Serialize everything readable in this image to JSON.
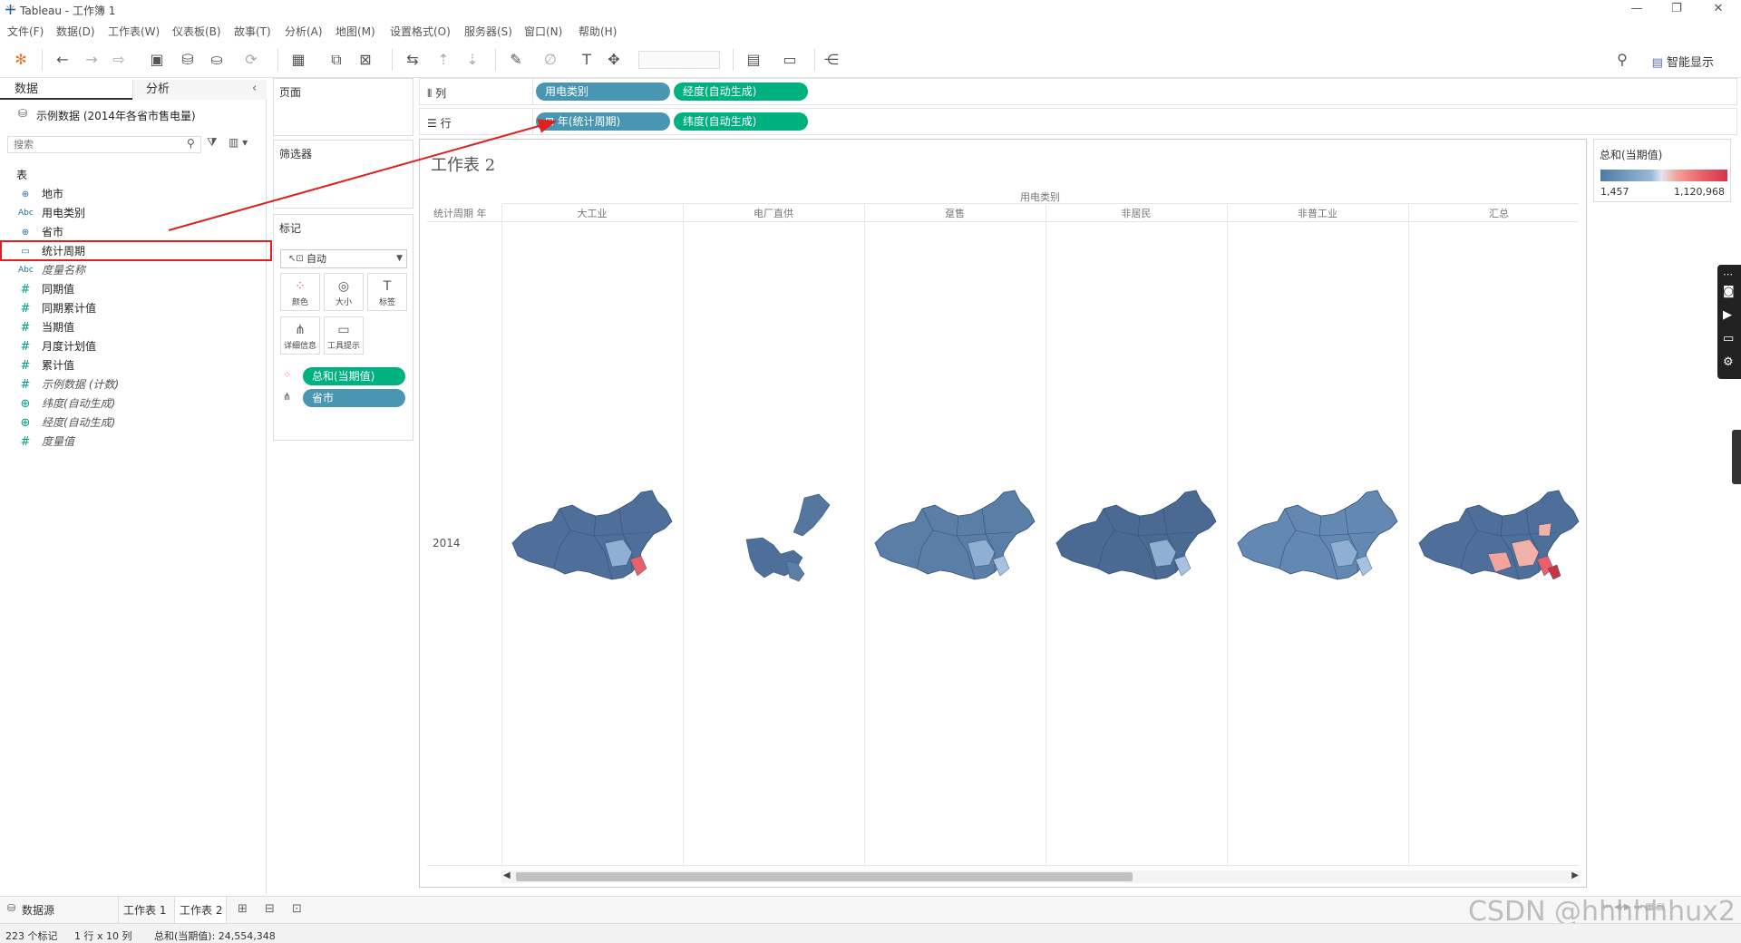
{
  "window": {
    "title": "Tableau - 工作簿 1"
  },
  "menu": [
    "文件(F)",
    "数据(D)",
    "工作表(W)",
    "仪表板(B)",
    "故事(T)",
    "分析(A)",
    "地图(M)",
    "设置格式(O)",
    "服务器(S)",
    "窗口(N)",
    "帮助(H)"
  ],
  "toolbar": {
    "smart_show": "智能显示"
  },
  "data_pane": {
    "tab_data": "数据",
    "tab_analysis": "分析",
    "datasource": "示例数据 (2014年各省市售电量)",
    "search_placeholder": "搜索",
    "section_label": "表",
    "fields": [
      {
        "icon": "globe-icon",
        "type": "geo",
        "name": "地市"
      },
      {
        "icon": "abc-icon",
        "type": "dim",
        "name": "用电类别"
      },
      {
        "icon": "globe-icon",
        "type": "geo",
        "name": "省市"
      },
      {
        "icon": "calendar-icon",
        "type": "date",
        "name": "统计周期",
        "selected": true
      },
      {
        "icon": "abc-icon",
        "type": "dim",
        "name": "度量名称",
        "italic": true
      },
      {
        "icon": "hash-icon",
        "type": "meas",
        "name": "同期值"
      },
      {
        "icon": "hash-icon",
        "type": "meas",
        "name": "同期累计值"
      },
      {
        "icon": "hash-icon",
        "type": "meas",
        "name": "当期值"
      },
      {
        "icon": "hash-icon",
        "type": "meas",
        "name": "月度计划值"
      },
      {
        "icon": "hash-icon",
        "type": "meas",
        "name": "累计值"
      },
      {
        "icon": "hash-icon",
        "type": "meas",
        "name": "示例数据 (计数)",
        "italic": true
      },
      {
        "icon": "globe-icon",
        "type": "geomeas",
        "name": "纬度(自动生成)",
        "italic": true
      },
      {
        "icon": "globe-icon",
        "type": "geomeas",
        "name": "经度(自动生成)",
        "italic": true
      },
      {
        "icon": "hash-icon",
        "type": "meas",
        "name": "度量值",
        "italic": true
      }
    ]
  },
  "cards": {
    "pages": "页面",
    "filters": "筛选器",
    "marks": "标记",
    "mark_type": "自动",
    "mark_buttons": [
      "颜色",
      "大小",
      "标签",
      "详细信息",
      "工具提示"
    ],
    "mark_pills": [
      {
        "label": "总和(当期值)",
        "kind": "measure",
        "icon": "color-icon"
      },
      {
        "label": "省市",
        "kind": "dimension",
        "icon": "detail-icon"
      }
    ]
  },
  "shelves": {
    "columns_label": "列",
    "rows_label": "行",
    "columns": [
      {
        "label": "用电类别",
        "kind": "dimension"
      },
      {
        "label": "经度(自动生成)",
        "kind": "measure"
      }
    ],
    "rows": [
      {
        "label": "⊞ 年(统计周期)",
        "kind": "dimension"
      },
      {
        "label": "纬度(自动生成)",
        "kind": "measure"
      }
    ]
  },
  "view": {
    "sheet_title": "工作表 2",
    "column_group_header": "用电类别",
    "row_header_label": "统计周期 年",
    "column_headers": [
      "大工业",
      "电厂直供",
      "趸售",
      "非居民",
      "非普工业",
      "汇总"
    ],
    "row_value": "2014"
  },
  "legend": {
    "title": "总和(当期值)",
    "min": "1,457",
    "max": "1,120,968"
  },
  "sheet_tabs": {
    "datasource": "数据源",
    "sheets": [
      "工作表 1",
      "工作表 2"
    ],
    "active": "工作表 2"
  },
  "status": {
    "marks": "223 个标记",
    "dims": "1 行 x 10 列",
    "sum": "总和(当期值): 24,554,348"
  },
  "watermark": "CSDN @hhhhhhux2"
}
